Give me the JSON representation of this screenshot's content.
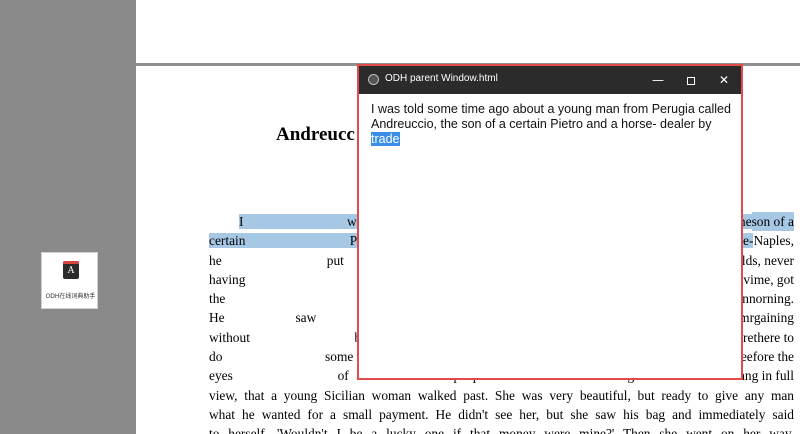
{
  "launcher": {
    "app_label": "ODH在线词典助手",
    "app_icon_glyph": "A"
  },
  "document": {
    "title_visible": "Andreucc",
    "paragraph_lines": [
      {
        "pre": "",
        "hl": "I was told some time",
        "post": "",
        "right_hl": "son of a"
      },
      {
        "pre": "",
        "hl": "certain Pietro and a horse-",
        "post": "",
        "right": "Naples,"
      },
      {
        "pre": "he put five- hundred gold",
        "right": "s, never"
      },
      {
        "pre": "having previously been av",
        "right": "ime, got"
      },
      {
        "pre": "the necessary information",
        "right": "norning."
      },
      {
        "pre": "He saw a lot of horses, m",
        "right": "rgaining"
      },
      {
        "pre": "without being able to agre",
        "right": "there to"
      },
      {
        "pre": "do some buying and naive",
        "right": "efore the"
      },
      {
        "pre": "eyes of people coming an",
        "right": "g in full"
      },
      {
        "pre": "view, that a young Sicilian woman walked past. She was very beautiful, but ready to give any man"
      },
      {
        "pre": "what he wanted for a small payment. He didn't see her, but she saw his bag and immediately said"
      },
      {
        "pre": "to herself, 'Wouldn't I be a lucky one if that money were mine?' Then she went on her way."
      }
    ]
  },
  "popup": {
    "title": "ODH parent Window.html",
    "minimize_glyph": "—",
    "close_glyph": "✕",
    "text_before": "I was told some time ago about a young man from Perugia called Andreuccio, the son of a certain Pietro and a horse- dealer by ",
    "selected_word": "trade"
  },
  "colors": {
    "selection_doc": "#a6c8e4",
    "selection_popup": "#3b8ee8",
    "popup_border": "#e24b4b",
    "titlebar": "#2b2b2b"
  }
}
